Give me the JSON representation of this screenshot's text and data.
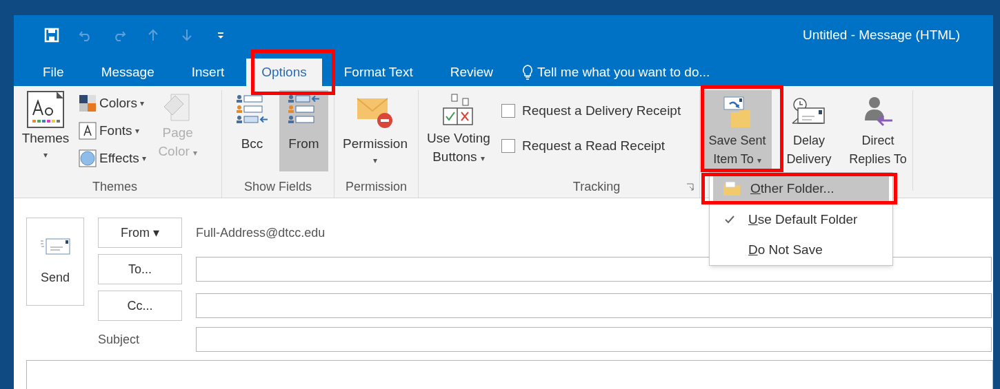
{
  "window": {
    "title": "Untitled - Message (HTML)"
  },
  "quick_access": [
    {
      "kind": "save",
      "disabled": false
    },
    {
      "kind": "undo",
      "disabled": true
    },
    {
      "kind": "redo",
      "disabled": true
    },
    {
      "kind": "up",
      "disabled": true
    },
    {
      "kind": "down",
      "disabled": true
    },
    {
      "kind": "customize",
      "disabled": false
    }
  ],
  "tabs": [
    {
      "label": "File",
      "selected": false
    },
    {
      "label": "Message",
      "selected": false
    },
    {
      "label": "Insert",
      "selected": false
    },
    {
      "label": "Options",
      "selected": true
    },
    {
      "label": "Format Text",
      "selected": false
    },
    {
      "label": "Review",
      "selected": false
    }
  ],
  "tell_me": {
    "placeholder": "Tell me what you want to do..."
  },
  "ribbon": {
    "themes": {
      "label": "Themes",
      "big": {
        "label": "Themes",
        "caret": "▾"
      },
      "small": [
        {
          "kind": "colors",
          "label": "Colors",
          "caret": "▾"
        },
        {
          "kind": "fonts",
          "label": "Fonts",
          "caret": "▾"
        },
        {
          "kind": "effects",
          "label": "Effects",
          "caret": "▾"
        }
      ],
      "page_color": {
        "label": "Page Color",
        "caret": "▾",
        "disabled": true
      }
    },
    "show_fields": {
      "label": "Show Fields",
      "buttons": [
        {
          "kind": "bcc",
          "label": "Bcc",
          "selected": false
        },
        {
          "kind": "from",
          "label": "From",
          "selected": true
        }
      ]
    },
    "permission": {
      "label": "Permission",
      "button": {
        "label": "Permission",
        "caret": "▾"
      }
    },
    "tracking": {
      "label": "Tracking",
      "voting": {
        "label": "Use Voting Buttons",
        "caret": "▾"
      },
      "checks": [
        {
          "label": "Request a Delivery Receipt",
          "checked": false
        },
        {
          "label": "Request a Read Receipt",
          "checked": false
        }
      ]
    },
    "more_options": {
      "buttons": [
        {
          "kind": "save_sent",
          "label": "Save Sent Item To",
          "caret": "▾",
          "selected": true
        },
        {
          "kind": "delay",
          "label": "Delay Delivery",
          "selected": false
        },
        {
          "kind": "direct",
          "label": "Direct Replies To",
          "selected": false
        }
      ]
    }
  },
  "dropdown": {
    "items": [
      {
        "label": "Other Folder...",
        "checked": false,
        "selected": true
      },
      {
        "label": "Use Default Folder",
        "checked": true,
        "selected": false
      },
      {
        "label": "Do Not Save",
        "checked": false,
        "selected": false
      }
    ]
  },
  "compose": {
    "send": "Send",
    "from_button": "From ▾",
    "from_address": "Full-Address@dtcc.edu",
    "to_button": "To...",
    "cc_button": "Cc...",
    "subject_label": "Subject"
  }
}
